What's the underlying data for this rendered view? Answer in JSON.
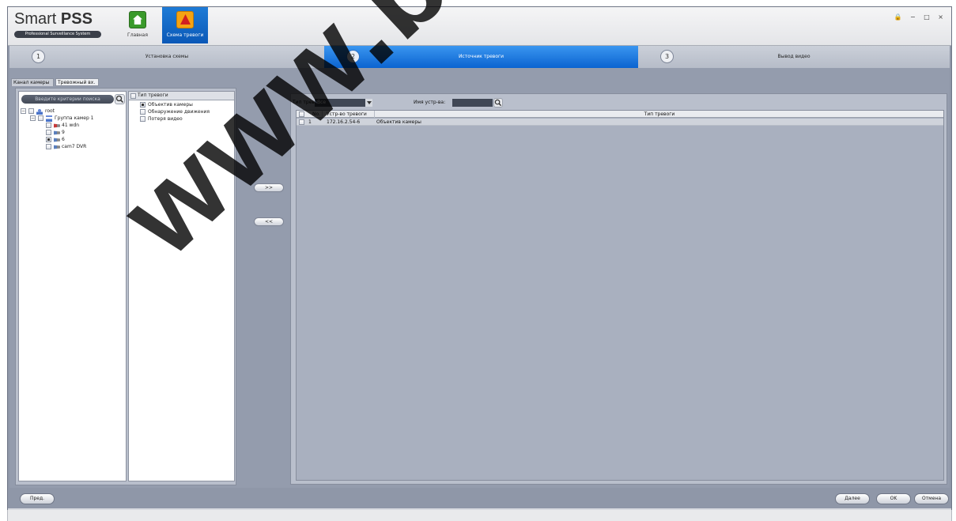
{
  "app": {
    "logo_text_light": "Smart ",
    "logo_text_bold": "PSS",
    "logo_tagline": "Professional Surveillance System",
    "window_controls": "🔒 − □ ×"
  },
  "nav": {
    "home_label": "Главная",
    "alarm_label": "Схема тревоги"
  },
  "steps": [
    {
      "num": "1",
      "label": "Установка схемы"
    },
    {
      "num": "2",
      "label": "Источник тревоги"
    },
    {
      "num": "3",
      "label": "Вывод видео"
    }
  ],
  "tabs": {
    "camera": "Канал камеры",
    "alarm_input": "Тревожный вх."
  },
  "tree": {
    "search_placeholder": "Введите критерии поиска",
    "nodes": [
      {
        "label": "root"
      },
      {
        "label": "Группа камер 1"
      },
      {
        "label": "41 wdn"
      },
      {
        "label": "9"
      },
      {
        "label": "6"
      },
      {
        "label": "cam7 DVR"
      }
    ]
  },
  "alarm_types": {
    "header": "Тип тревоги",
    "items": [
      {
        "label": "Объектив камеры"
      },
      {
        "label": "Обнаружение движения"
      },
      {
        "label": "Потеря видео"
      }
    ]
  },
  "move": {
    "add": ">>",
    "remove": "<<"
  },
  "filter": {
    "type_label": "Тип тревоги",
    "type_value": "Все",
    "name_label": "Имя устр-ва:",
    "name_value": ""
  },
  "table": {
    "headers": [
      "No.",
      "Устр-во тревоги",
      "Тип тревоги"
    ],
    "rows": [
      [
        "1",
        "172.16.2.54-6",
        "Объектив камеры"
      ]
    ]
  },
  "buttons": {
    "prev": "Пред.",
    "next": "Далее",
    "ok": "OK",
    "cancel": "Отмена"
  },
  "watermark": "www.bez"
}
